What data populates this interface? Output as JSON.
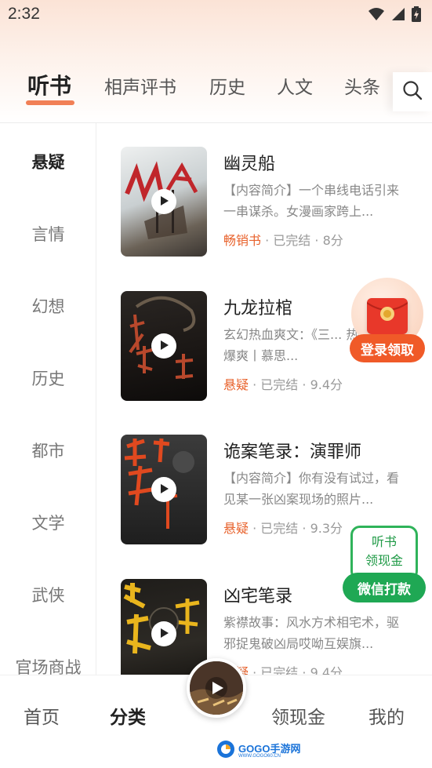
{
  "status_bar": {
    "time": "2:32"
  },
  "category_tabs": [
    {
      "label": "听书",
      "active": true
    },
    {
      "label": "相声评书",
      "active": false
    },
    {
      "label": "历史",
      "active": false
    },
    {
      "label": "人文",
      "active": false
    },
    {
      "label": "头条",
      "active": false
    }
  ],
  "search_icon": "search-icon",
  "sidebar": {
    "items": [
      {
        "label": "悬疑",
        "active": true
      },
      {
        "label": "言情",
        "active": false
      },
      {
        "label": "幻想",
        "active": false
      },
      {
        "label": "历史",
        "active": false
      },
      {
        "label": "都市",
        "active": false
      },
      {
        "label": "文学",
        "active": false
      },
      {
        "label": "武侠",
        "active": false
      },
      {
        "label": "官场商战",
        "active": false
      }
    ]
  },
  "books": [
    {
      "title": "幽灵船",
      "description": "【内容简介】一个串线电话引来一串谋杀。女漫画家跨上...",
      "tag": "畅销书",
      "status": "已完结",
      "score": "8分"
    },
    {
      "title": "九龙拉棺",
      "description": "玄幻热血爽文：《三... 热血玄幻爆爽丨慕思...",
      "tag": "悬疑",
      "status": "已完结",
      "score": "9.4分"
    },
    {
      "title": "诡案笔录：演罪师",
      "description": "【内容简介】你有没有试过，看见某一张凶案现场的照片...",
      "tag": "悬疑",
      "status": "已完结",
      "score": "9.3分"
    },
    {
      "title": "凶宅笔录",
      "description": "紫襟故事：风水方术相宅术，驱邪捉鬼破凶局哎呦互娱旗...",
      "tag": "悬疑",
      "status": "已完结",
      "score": "9.4分"
    }
  ],
  "meta_separator": " · ",
  "floating": {
    "redpack_label": "登录领取",
    "cash_line1": "听书",
    "cash_line2": "领现金",
    "cash_button": "微信打款"
  },
  "bottom_nav": [
    {
      "label": "首页",
      "active": false
    },
    {
      "label": "分类",
      "active": true
    },
    {
      "label": "领现金",
      "active": false
    },
    {
      "label": "我的",
      "active": false
    }
  ],
  "watermark": {
    "text": "GOGO手游网",
    "sub": "WWW.GOGO60.CN"
  },
  "colors": {
    "accent": "#e8622c",
    "green": "#1fa854",
    "tab_underline": "#ef6a3a"
  }
}
